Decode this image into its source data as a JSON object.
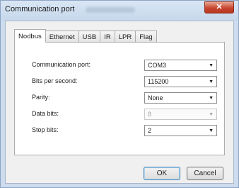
{
  "window": {
    "title": "Communication port",
    "close_glyph": "✕"
  },
  "tabs": [
    {
      "label": "Nodbus",
      "active": true
    },
    {
      "label": "Ethernet",
      "active": false
    },
    {
      "label": "USB",
      "active": false
    },
    {
      "label": "IR",
      "active": false
    },
    {
      "label": "LPR",
      "active": false
    },
    {
      "label": "Flag",
      "active": false
    }
  ],
  "form": {
    "rows": [
      {
        "label": "Communication port:",
        "value": "COM3",
        "enabled": true
      },
      {
        "label": "Bits per second:",
        "value": "115200",
        "enabled": true
      },
      {
        "label": "Parity:",
        "value": "None",
        "enabled": true
      },
      {
        "label": "Data bits:",
        "value": "8",
        "enabled": false
      },
      {
        "label": "Stop bits:",
        "value": "2",
        "enabled": true
      }
    ]
  },
  "buttons": {
    "ok": "OK",
    "cancel": "Cancel"
  },
  "icons": {
    "dropdown_arrow": "▼"
  }
}
